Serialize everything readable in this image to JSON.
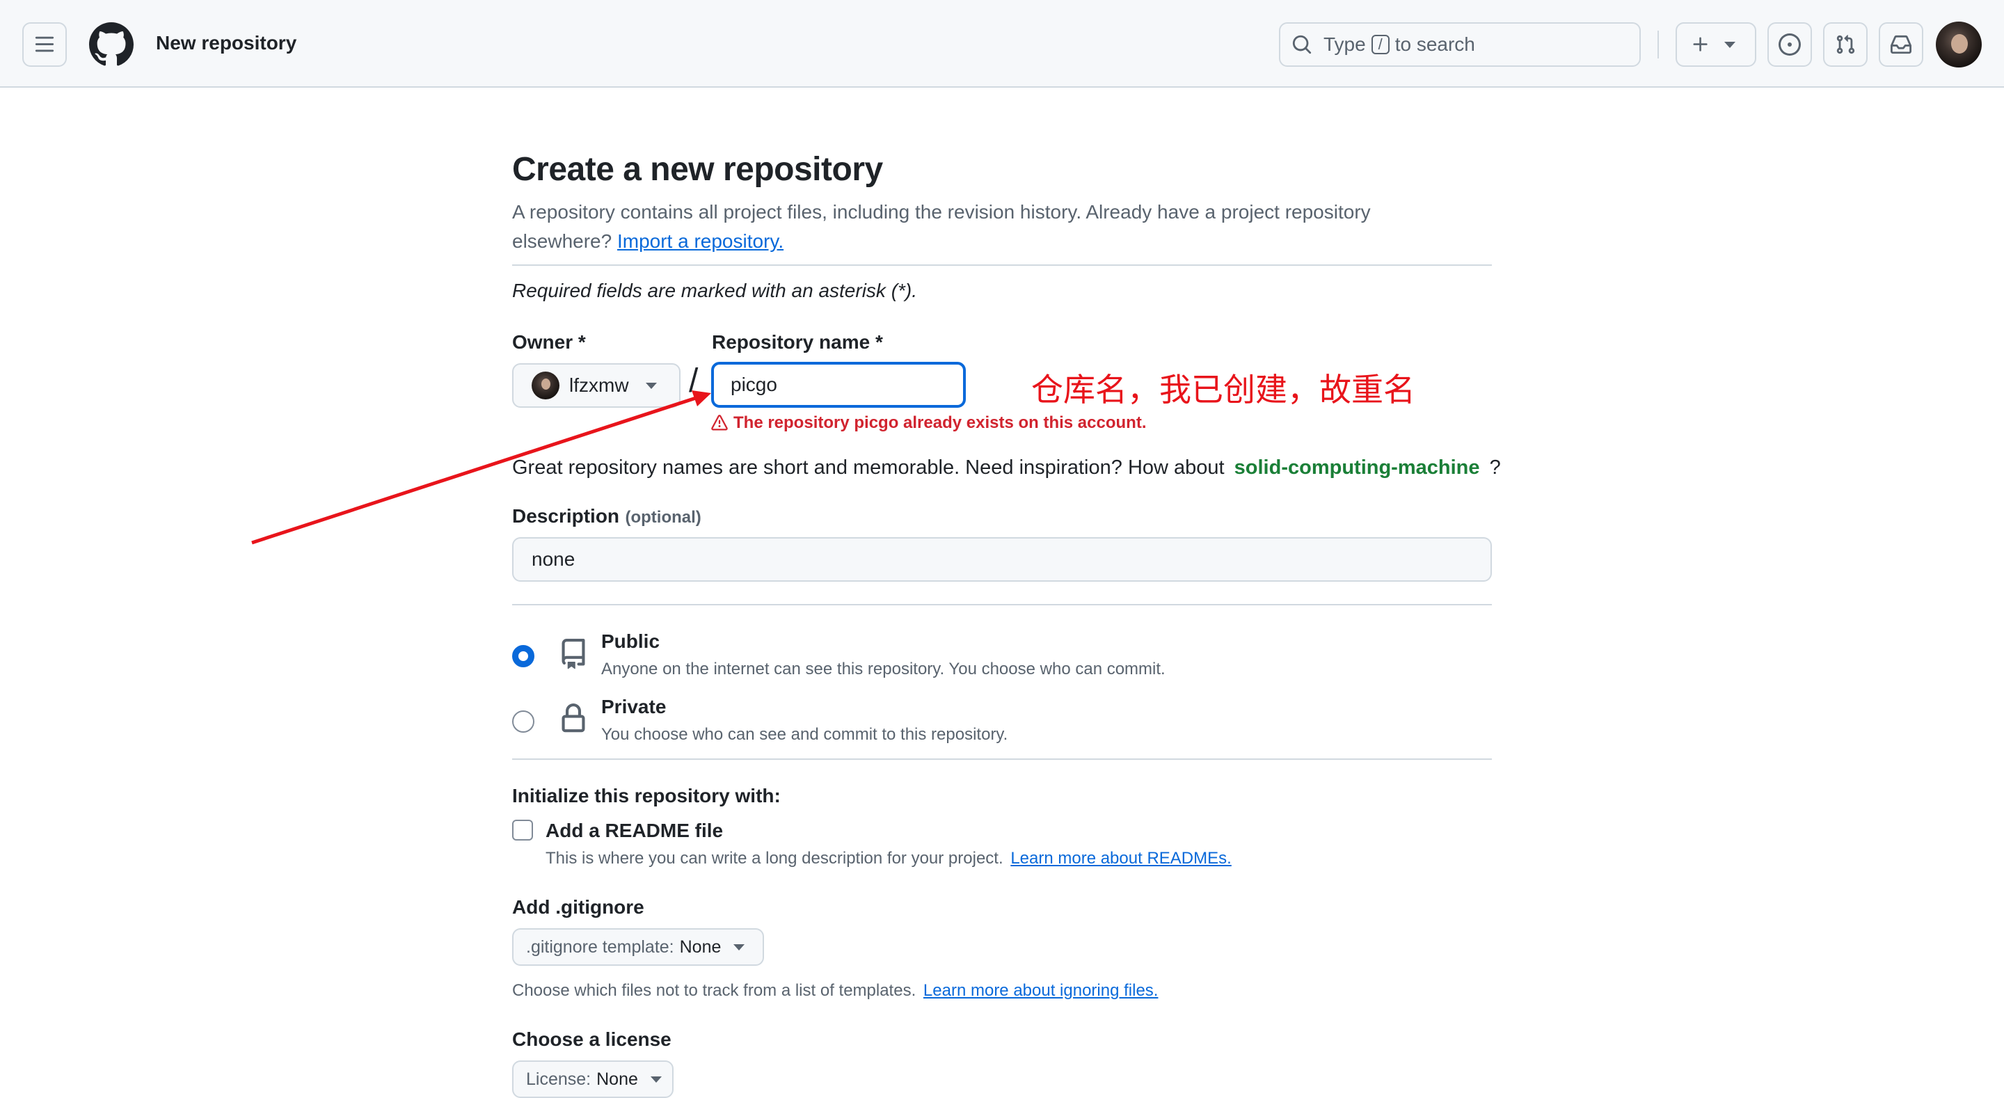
{
  "header": {
    "title": "New repository",
    "search_prefix": "Type",
    "search_key": "/",
    "search_suffix": "to search",
    "icons": [
      "menu-icon",
      "github-logo-icon",
      "search-icon",
      "plus-icon",
      "chevron-down-icon",
      "issues-icon",
      "pull-request-icon",
      "inbox-icon",
      "avatar"
    ]
  },
  "page": {
    "heading": "Create a new repository",
    "intro": "A repository contains all project files, including the revision history. Already have a project repository",
    "intro_line2": "elsewhere?",
    "import_link": "Import a repository.",
    "required_note": "Required fields are marked with an asterisk (*)."
  },
  "owner": {
    "label": "Owner *",
    "value": "lfzxmw"
  },
  "repo": {
    "label": "Repository name *",
    "value": "picgo",
    "error": "The repository picgo already exists on this account.",
    "annotation": "仓库名，我已创建，故重名"
  },
  "suggestion": {
    "text": "Great repository names are short and memorable. Need inspiration? How about",
    "name": "solid-computing-machine",
    "end": "?"
  },
  "description": {
    "label": "Description",
    "optional": "(optional)",
    "value": "none"
  },
  "visibility": {
    "selected": "public",
    "public_label": "Public",
    "public_desc": "Anyone on the internet can see this repository. You choose who can commit.",
    "private_label": "Private",
    "private_desc": "You choose who can see and commit to this repository."
  },
  "init": {
    "heading": "Initialize this repository with:",
    "readme_label": "Add a README file",
    "readme_checked": false,
    "readme_desc": "This is where you can write a long description for your project.",
    "readme_link": "Learn more about READMEs."
  },
  "gitignore": {
    "heading": "Add .gitignore",
    "button_prefix": ".gitignore template:",
    "button_value": "None",
    "desc": "Choose which files not to track from a list of templates.",
    "link": "Learn more about ignoring files."
  },
  "license": {
    "heading": "Choose a license",
    "button_prefix": "License:",
    "button_value": "None"
  },
  "colors": {
    "accent": "#0969da",
    "danger": "#d1242f",
    "success": "#1a7f37",
    "annotation": "#e8141b"
  }
}
